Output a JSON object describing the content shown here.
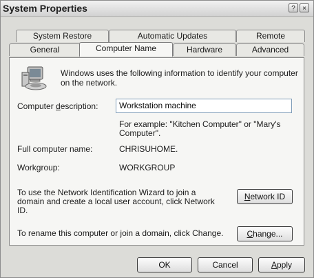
{
  "window": {
    "title": "System Properties",
    "help_symbol": "?",
    "close_symbol": "×"
  },
  "tabs": {
    "row_back": [
      "System Restore",
      "Automatic Updates",
      "Remote"
    ],
    "row_front": [
      "General",
      "Computer Name",
      "Hardware",
      "Advanced"
    ],
    "active": "Computer Name"
  },
  "panel": {
    "intro_line1": "Windows uses the following information to identify your computer",
    "intro_line2": "on the network.",
    "description_label_pre": "Computer ",
    "description_label_u": "d",
    "description_label_post": "escription:",
    "description_value": "Workstation machine",
    "example_line1": "For example: \"Kitchen Computer\" or \"Mary's",
    "example_line2": "Computer\".",
    "fullname_label": "Full computer name:",
    "fullname_value": "CHRISUHOME.",
    "workgroup_label": "Workgroup:",
    "workgroup_value": "WORKGROUP",
    "wizard_line1": "To use the Network Identification Wizard to join a",
    "wizard_line2": "domain and create a local user account, click Network",
    "wizard_line3": "ID.",
    "network_id_u": "N",
    "network_id_rest": "etwork ID",
    "rename_text": "To rename this computer or join a domain, click Change.",
    "change_u": "C",
    "change_rest": "hange..."
  },
  "footer": {
    "ok_label": "OK",
    "cancel_label": "Cancel",
    "apply_u": "A",
    "apply_rest": "pply"
  },
  "icons": {
    "computer": "computer-network-icon"
  }
}
